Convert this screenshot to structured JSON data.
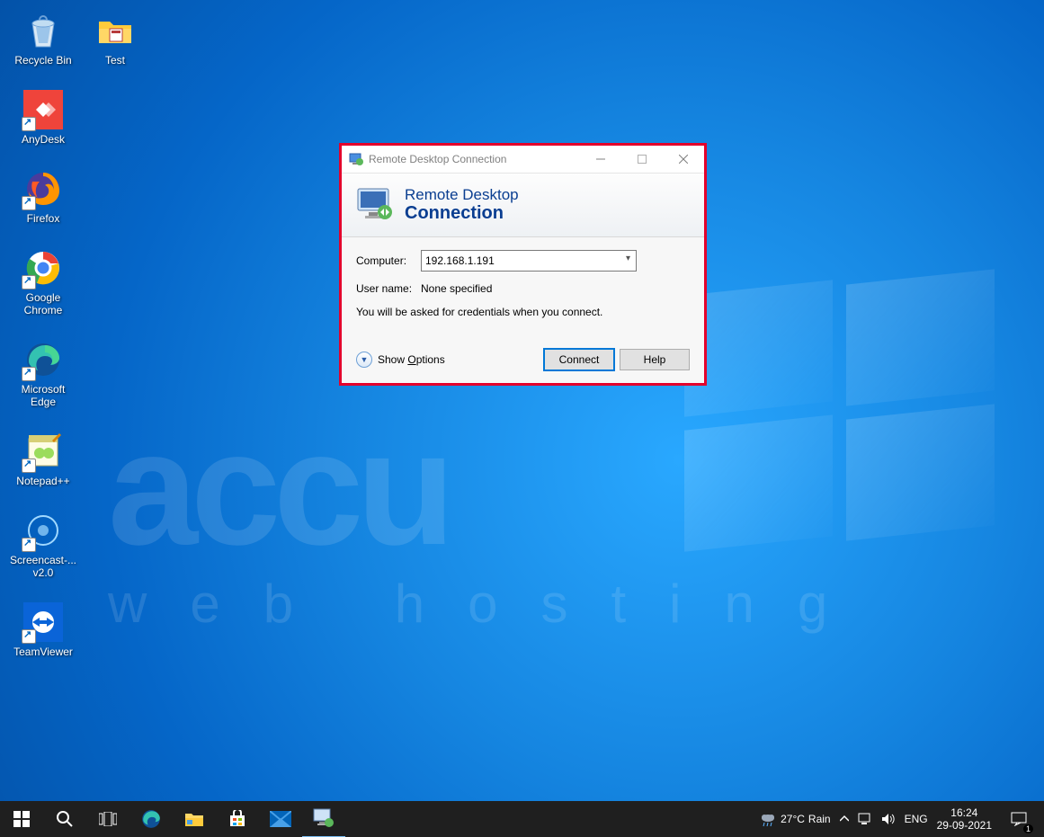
{
  "desktop": {
    "watermark_top": "accu",
    "watermark_sub": "web hosting",
    "icons_col1": [
      {
        "label": "Recycle Bin",
        "name": "recycle-bin-icon"
      },
      {
        "label": "AnyDesk",
        "name": "anydesk-icon"
      },
      {
        "label": "Firefox",
        "name": "firefox-icon"
      },
      {
        "label": "Google Chrome",
        "name": "chrome-icon"
      },
      {
        "label": "Microsoft Edge",
        "name": "edge-icon"
      },
      {
        "label": "Notepad++",
        "name": "notepadpp-icon"
      },
      {
        "label": "Screencast-... v2.0",
        "name": "screencast-icon"
      },
      {
        "label": "TeamViewer",
        "name": "teamviewer-icon"
      }
    ],
    "icons_col2": [
      {
        "label": "Test",
        "name": "folder-icon"
      }
    ]
  },
  "rdc": {
    "title": "Remote Desktop Connection",
    "banner_line1": "Remote Desktop",
    "banner_line2": "Connection",
    "computer_label": "Computer:",
    "computer_value": "192.168.1.191",
    "username_label": "User name:",
    "username_value": "None specified",
    "hint": "You will be asked for credentials when you connect.",
    "show_options": "Show Options",
    "connect": "Connect",
    "help": "Help"
  },
  "taskbar": {
    "weather_temp": "27°C",
    "weather_cond": "Rain",
    "lang": "ENG",
    "time": "16:24",
    "date": "29-09-2021",
    "notif_count": "1"
  }
}
